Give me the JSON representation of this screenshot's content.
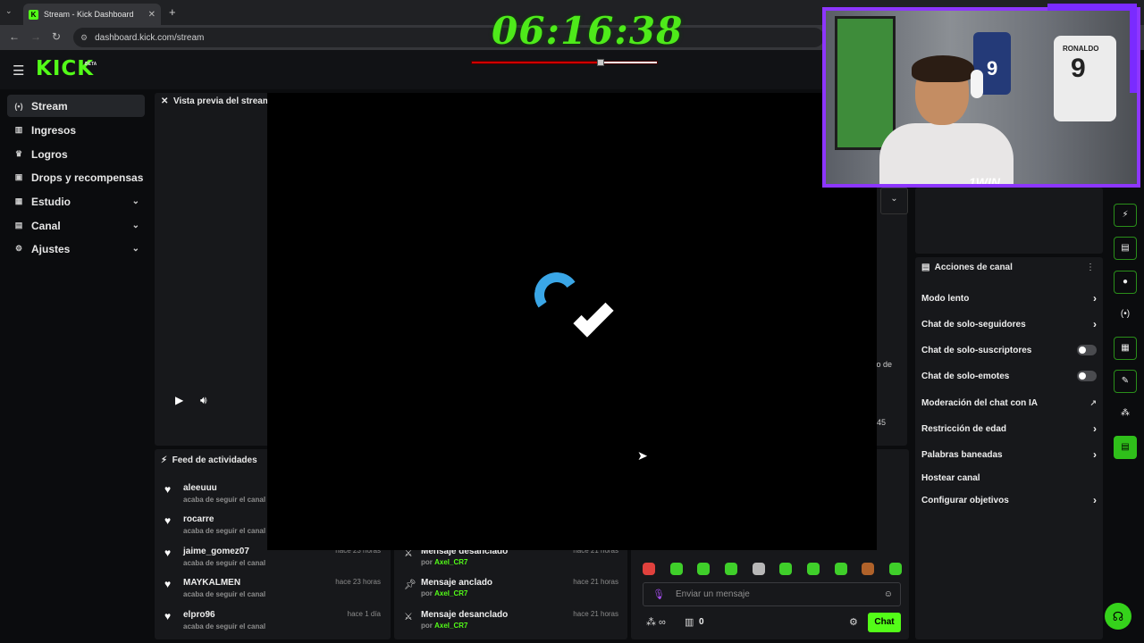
{
  "browser": {
    "tab_title": "Stream - Kick Dashboard",
    "url": "dashboard.kick.com/stream"
  },
  "overlay": {
    "timer": "06:16:38",
    "health_fraction": 0.69
  },
  "header": {
    "logo": "KICK",
    "beta": "BETA"
  },
  "sidebar": {
    "items": [
      {
        "label": "Stream",
        "icon": "broadcast-icon"
      },
      {
        "label": "Ingresos",
        "icon": "chart-icon"
      },
      {
        "label": "Logros",
        "icon": "trophy-icon"
      },
      {
        "label": "Drops y recompensas",
        "icon": "gift-icon"
      },
      {
        "label": "Estudio",
        "icon": "studio-icon"
      },
      {
        "label": "Canal",
        "icon": "channel-icon"
      },
      {
        "label": "Ajustes",
        "icon": "gear-icon"
      }
    ]
  },
  "preview": {
    "title": "Vista previa del stream",
    "side_text_1": "to de",
    "side_text_2": "45"
  },
  "feed": {
    "title": "Feed de actividades",
    "rows": [
      {
        "user": "aleeuuu",
        "sub": "acaba de seguir el canal",
        "time": ""
      },
      {
        "user": "rocarre",
        "sub": "acaba de seguir el canal",
        "time": ""
      },
      {
        "user": "jaime_gomez07",
        "sub": "acaba de seguir el canal",
        "time": "hace 23 horas"
      },
      {
        "user": "MAYKALMEN",
        "sub": "acaba de seguir el canal",
        "time": "hace 23 horas"
      },
      {
        "user": "elpro96",
        "sub": "acaba de seguir el canal",
        "time": "hace 1 día"
      }
    ]
  },
  "mod_log": {
    "rows": [
      {
        "action": "Mensaje desanclado",
        "by_prefix": "por",
        "by": "Axel_CR7",
        "time": "hace 21 horas"
      },
      {
        "action": "Mensaje anclado",
        "by_prefix": "por",
        "by": "Axel_CR7",
        "time": "hace 21 horas"
      },
      {
        "action": "Mensaje desanclado",
        "by_prefix": "por",
        "by": "Axel_CR7",
        "time": "hace 21 horas"
      }
    ]
  },
  "chat": {
    "placeholder": "Enviar un mensaje",
    "points": "0",
    "send_label": "Chat"
  },
  "actions": {
    "title": "Acciones de canal",
    "items": [
      {
        "label": "Modo lento",
        "control": "arrow"
      },
      {
        "label": "Chat de solo-seguidores",
        "control": "arrow"
      },
      {
        "label": "Chat de solo-suscriptores",
        "control": "toggle"
      },
      {
        "label": "Chat de solo-emotes",
        "control": "toggle"
      },
      {
        "label": "Moderación del chat con IA",
        "control": "external"
      },
      {
        "label": "Restricción de edad",
        "control": "arrow"
      },
      {
        "label": "Palabras baneadas",
        "control": "arrow"
      },
      {
        "label": "Hostear canal",
        "control": "none"
      },
      {
        "label": "Configurar objetivos",
        "control": "arrow"
      }
    ]
  },
  "webcam": {
    "sponsor": "1WIN",
    "jersey_name": "RONALDO",
    "jersey_number": "9",
    "jersey_number_2": "9"
  },
  "colors": {
    "accent": "#53fc18",
    "webcam_frame": "#8d36ff",
    "timer": "#4eea1a"
  }
}
